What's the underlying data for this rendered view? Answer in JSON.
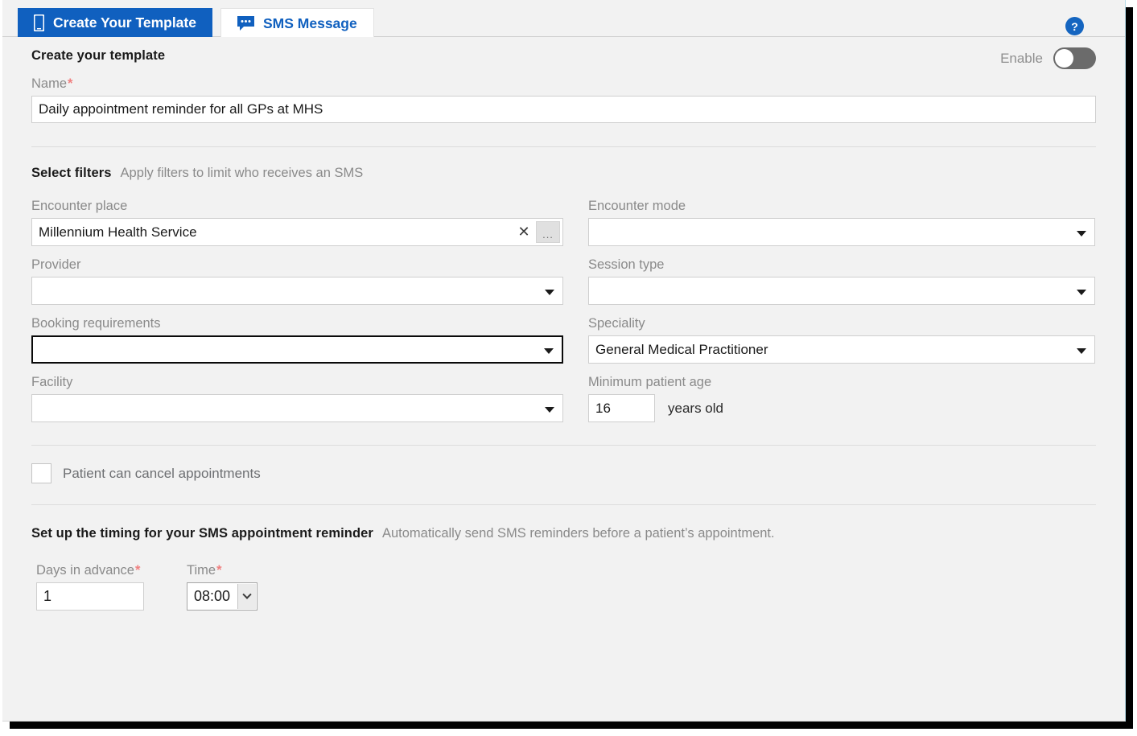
{
  "tabs": [
    {
      "label": "Create Your Template",
      "icon": "mobile-phone-icon",
      "active": true
    },
    {
      "label": "SMS Message",
      "icon": "speech-bubble-icon",
      "active": false
    }
  ],
  "help": {
    "icon": "help-circle-icon",
    "glyph": "?"
  },
  "create_section": {
    "title": "Create your template",
    "enable": {
      "label": "Enable",
      "state": "off"
    },
    "name": {
      "label": "Name",
      "required_marker": "*",
      "value": "Daily appointment reminder for all GPs at MHS"
    }
  },
  "filters_section": {
    "title": "Select filters",
    "subtitle": "Apply filters to limit who receives an SMS",
    "encounter_place": {
      "label": "Encounter place",
      "value": "Millennium Health Service",
      "clear_glyph": "✕",
      "browse_glyph": "..."
    },
    "encounter_mode": {
      "label": "Encounter mode",
      "value": ""
    },
    "provider": {
      "label": "Provider",
      "value": ""
    },
    "session_type": {
      "label": "Session type",
      "value": ""
    },
    "booking_requirements": {
      "label": "Booking requirements",
      "value": "",
      "focused": true
    },
    "speciality": {
      "label": "Speciality",
      "value": "General Medical Practitioner"
    },
    "facility": {
      "label": "Facility",
      "value": ""
    },
    "minimum_patient_age": {
      "label": "Minimum patient age",
      "value": "16",
      "suffix": "years old"
    },
    "patient_can_cancel": {
      "label": "Patient can cancel appointments",
      "checked": false
    }
  },
  "timing_section": {
    "title": "Set up the timing for your SMS appointment reminder",
    "subtitle": "Automatically send SMS reminders before a patient’s appointment.",
    "days_in_advance": {
      "label": "Days in advance",
      "required_marker": "*",
      "value": "1"
    },
    "time": {
      "label": "Time",
      "required_marker": "*",
      "value": "08:00"
    }
  },
  "colors": {
    "accent": "#1060bf",
    "page_bg": "#f2f2f2",
    "required": "#f08080",
    "toggle_off": "#6b6b6b"
  }
}
